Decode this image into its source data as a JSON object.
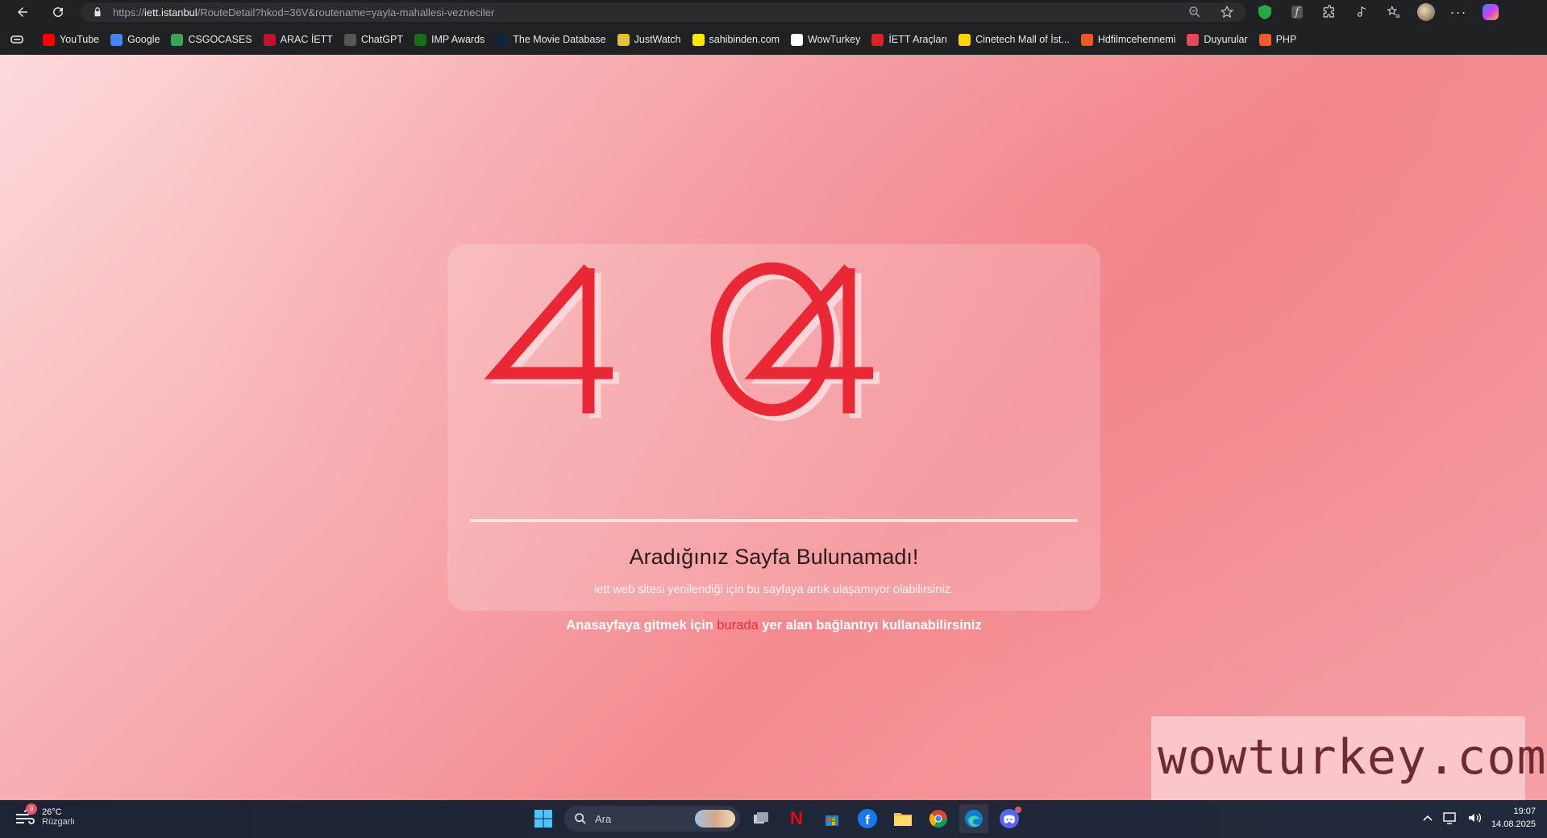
{
  "browser": {
    "url_host": "iett.istanbul",
    "url_prefix": "https://",
    "url_path": "/RouteDetail?hkod=36V&routename=yayla-mahallesi-vezneciler"
  },
  "bookmarks": [
    {
      "label": "YouTube",
      "icon": "youtube-icon",
      "color": "#ff0000"
    },
    {
      "label": "Google",
      "icon": "google-icon",
      "color": "#4285f4"
    },
    {
      "label": "CSGOCASES",
      "icon": "csgocases-icon",
      "color": "#3aa655"
    },
    {
      "label": "ARAC İETT",
      "icon": "iett-icon",
      "color": "#c8102e"
    },
    {
      "label": "ChatGPT",
      "icon": "chatgpt-icon",
      "color": "#555555"
    },
    {
      "label": "IMP Awards",
      "icon": "imp-icon",
      "color": "#1a6b1a"
    },
    {
      "label": "The Movie Database",
      "icon": "tmdb-icon",
      "color": "#0d253f"
    },
    {
      "label": "JustWatch",
      "icon": "justwatch-icon",
      "color": "#e3c035"
    },
    {
      "label": "sahibinden.com",
      "icon": "sahibinden-icon",
      "color": "#ffe800"
    },
    {
      "label": "WowTurkey",
      "icon": "wowturkey-icon",
      "color": "#ffffff"
    },
    {
      "label": "İETT Araçları",
      "icon": "iett-bus-icon",
      "color": "#e31e24"
    },
    {
      "label": "Cinetech Mall of İst...",
      "icon": "cinetech-icon",
      "color": "#ffd400"
    },
    {
      "label": "Hdfilmcehennemi",
      "icon": "hdfilm-icon",
      "color": "#e85d1f"
    },
    {
      "label": "Duyurular",
      "icon": "duyurular-icon",
      "color": "#e24a59"
    },
    {
      "label": "PHP",
      "icon": "php-icon",
      "color": "#ef5b2b"
    }
  ],
  "error": {
    "code": "404",
    "title": "Aradığınız Sayfa Bulunamadı!",
    "subtitle": "iett web sitesi yenilendiği için bu sayfaya artık ulaşamıyor olabilirsiniz.",
    "cta_before": "Anasayfaya gitmek için",
    "cta_link": "burada",
    "cta_after": "yer alan bağlantıyı kullanabilirsiniz",
    "accent": "#ef2a3a"
  },
  "watermark": "wowturkey.com",
  "taskbar": {
    "weather_temp": "26°C",
    "weather_desc": "Rüzgarlı",
    "weather_badge": "9",
    "search_placeholder": "Ara",
    "time": "19:07",
    "date": "14.08.2025"
  }
}
